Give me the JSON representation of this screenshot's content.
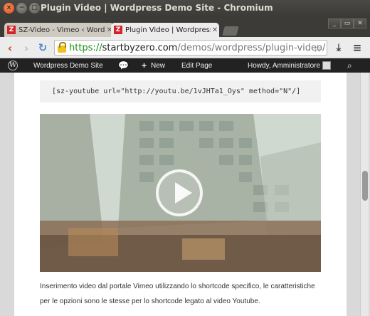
{
  "window": {
    "title": "Plugin Video | Wordpress Demo Site - Chromium"
  },
  "tabs": [
    {
      "label": "SZ-Video - Vimeo ‹ Wordp",
      "icon": "Z",
      "active": false
    },
    {
      "label": "Plugin Video | Wordpress D",
      "icon": "Z",
      "active": true
    }
  ],
  "toolbar": {
    "url_scheme": "https://",
    "url_host": "startbyzero.com",
    "url_path": "/demos/wordpress/plugin-video/"
  },
  "admin_bar": {
    "site_name": "Wordpress Demo Site",
    "new_label": "New",
    "edit_label": "Edit Page",
    "howdy": "Howdy, Amministratore"
  },
  "content": {
    "shortcode": "[sz-youtube url=\"http://youtu.be/1vJHTa1_Oys\" method=\"N\"/]",
    "description": "Inserimento video dal portale Vimeo utilizzando lo shortcode specifico, le caratteristiche per le opzioni sono le stesse per lo shortcode legato al video Youtube."
  },
  "colors": {
    "accent_orange": "#e0521d",
    "wp_bar": "#222222",
    "url_green": "#1a8f1a"
  }
}
